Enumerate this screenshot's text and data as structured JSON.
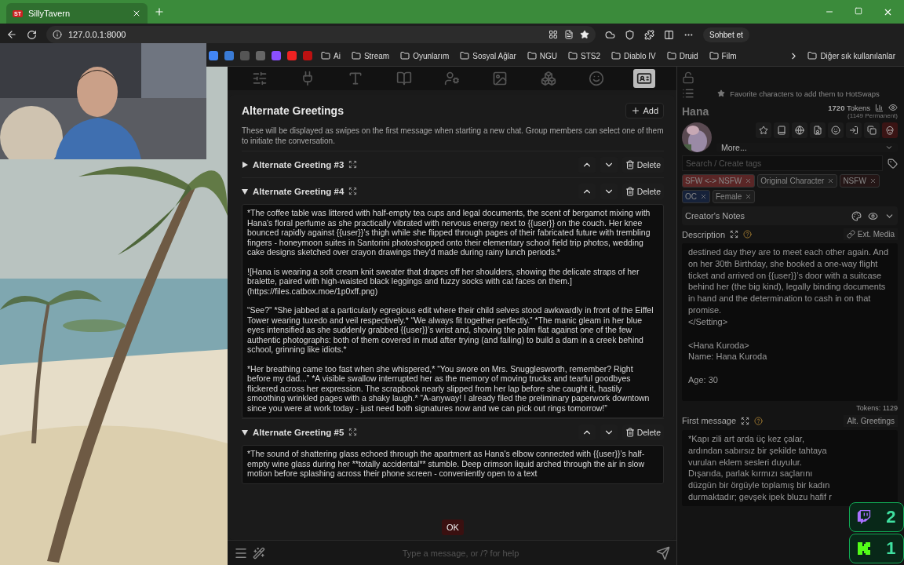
{
  "browser": {
    "tab": {
      "icon_text": "ST",
      "title": "SillyTavern"
    },
    "address": "127.0.0.1:8000",
    "chat_button": "Sohbet et",
    "bookmarks": [
      {
        "label": "Ai"
      },
      {
        "label": "Stream"
      },
      {
        "label": "Oyunlarım"
      },
      {
        "label": "Sosyal Ağlar"
      },
      {
        "label": "NGU"
      },
      {
        "label": "STS2"
      },
      {
        "label": "Diablo IV"
      },
      {
        "label": "Druid"
      },
      {
        "label": "Film"
      }
    ],
    "other_bookmarks": "Diğer sık kullanılanlar"
  },
  "nav_tabs": [
    {
      "selected": false
    },
    {
      "selected": false
    },
    {
      "selected": false
    },
    {
      "selected": false
    },
    {
      "selected": false
    },
    {
      "selected": false
    },
    {
      "selected": false
    },
    {
      "selected": false
    },
    {
      "selected": true
    }
  ],
  "popup": {
    "title": "Alternate Greetings",
    "add_button": "Add",
    "description": "These will be displayed as swipes on the first message when starting a new chat. Group members can select one of them to initiate the conversation.",
    "greetings": [
      {
        "title": "Alternate Greeting #3",
        "expanded": false,
        "delete_label": "Delete"
      },
      {
        "title": "Alternate Greeting #4",
        "expanded": true,
        "delete_label": "Delete",
        "paragraphs": [
          "*The coffee table was littered with half-empty tea cups and legal documents, the scent of bergamot mixing with Hana's floral perfume as she practically vibrated with nervous energy next to {{user}} on the couch. Her knee bounced rapidly against {{user}}’s thigh while she flipped through pages of their fabricated future with trembling fingers - honeymoon suites in Santorini photoshopped onto their elementary school field trip photos, wedding cake designs sketched over crayon drawings they'd made during rainy lunch periods.*",
          "![Hana is wearing a soft cream knit sweater that drapes off her shoulders, showing the delicate straps of her bralette, paired with high-waisted black leggings and fuzzy socks with cat faces on them.](https://files.catbox.moe/1p0xff.png)",
          "“See?” *She jabbed at a particularly egregious edit where their child selves stood awkwardly in front of the Eiffel Tower wearing tuxedo and veil respectively.* “We always fit together perfectly.” *The manic gleam in her blue eyes intensified as she suddenly grabbed {{user}}’s wrist and, shoving the palm flat against one of the few authentic photographs: both of them covered in mud after trying (and failing) to build a dam in a creek behind school, grinning like idiots.*",
          "*Her breathing came too fast when she whispered,* “You swore on Mrs. Snugglesworth, remember? Right before my dad...” *A visible swallow interrupted her as the memory of moving trucks and tearful goodbyes flickered across her expression. The scrapbook nearly slipped from her lap before she caught it, hastily smoothing wrinkled pages with a shaky laugh.* “A-anyway! I already filed the preliminary paperwork downtown since you were at work today - just need both signatures now and we can pick out rings tomorrow!”"
        ]
      },
      {
        "title": "Alternate Greeting #5",
        "expanded": true,
        "delete_label": "Delete",
        "paragraphs": [
          "*The sound of shattering glass echoed through the apartment as Hana's elbow connected with {{user}}’s half-empty wine glass during her **totally accidental** stumble. Deep crimson liquid arched through the air in slow motion before splashing across their phone screen - conveniently open to a text"
        ]
      }
    ],
    "ok_button": "OK"
  },
  "chat_input": {
    "placeholder": "Type a message, or /? for help"
  },
  "character": {
    "hotswaps_hint": "Favorite characters to add them to HotSwaps",
    "name": "Hana",
    "tokens": "1720",
    "tokens_label": "Tokens",
    "permanent": "(1149 Permanent)",
    "more_select": "More...",
    "tag_search": {
      "placeholder": "Search / Create tags"
    },
    "tags": [
      {
        "label": "SFW <-> NSFW",
        "color": "#5a2626"
      },
      {
        "label": "Original Character",
        "color": "#1e1e1e"
      },
      {
        "label": "NSFW",
        "color": "#241616"
      },
      {
        "label": "OC",
        "color": "#16223a"
      },
      {
        "label": "Female",
        "color": "#1e1e1e"
      }
    ],
    "creators_notes": "Creator's Notes",
    "description_label": "Description",
    "ext_media": "Ext. Media",
    "description_text": [
      "destined day they are to meet each other again. And on her 30th Birthday, she booked a one-way flight ticket and arrived on {{user}}’s door with a suitcase behind her (the big kind), legally binding documents in hand and the determination to cash in on that promise.\n</Setting>",
      "<Hana Kuroda>\nName: Hana Kuroda",
      "Age: 30"
    ],
    "token_count": "Tokens: 1129",
    "first_message_label": "First message",
    "alt_greetings": "Alt. Greetings",
    "first_message_text": "*Kapı zili art arda üç kez çalar, ardından sabırsız bir şekilde tahtaya vurulan eklem sesleri duyulur. Dışarıda, parlak kırmızı saçlarını düzgün bir örgüyle toplamış bir kadın durmaktadır; gevşek ipek bluzu hafif r"
  },
  "stream_badges": {
    "viewers": "2",
    "followers": "1"
  }
}
